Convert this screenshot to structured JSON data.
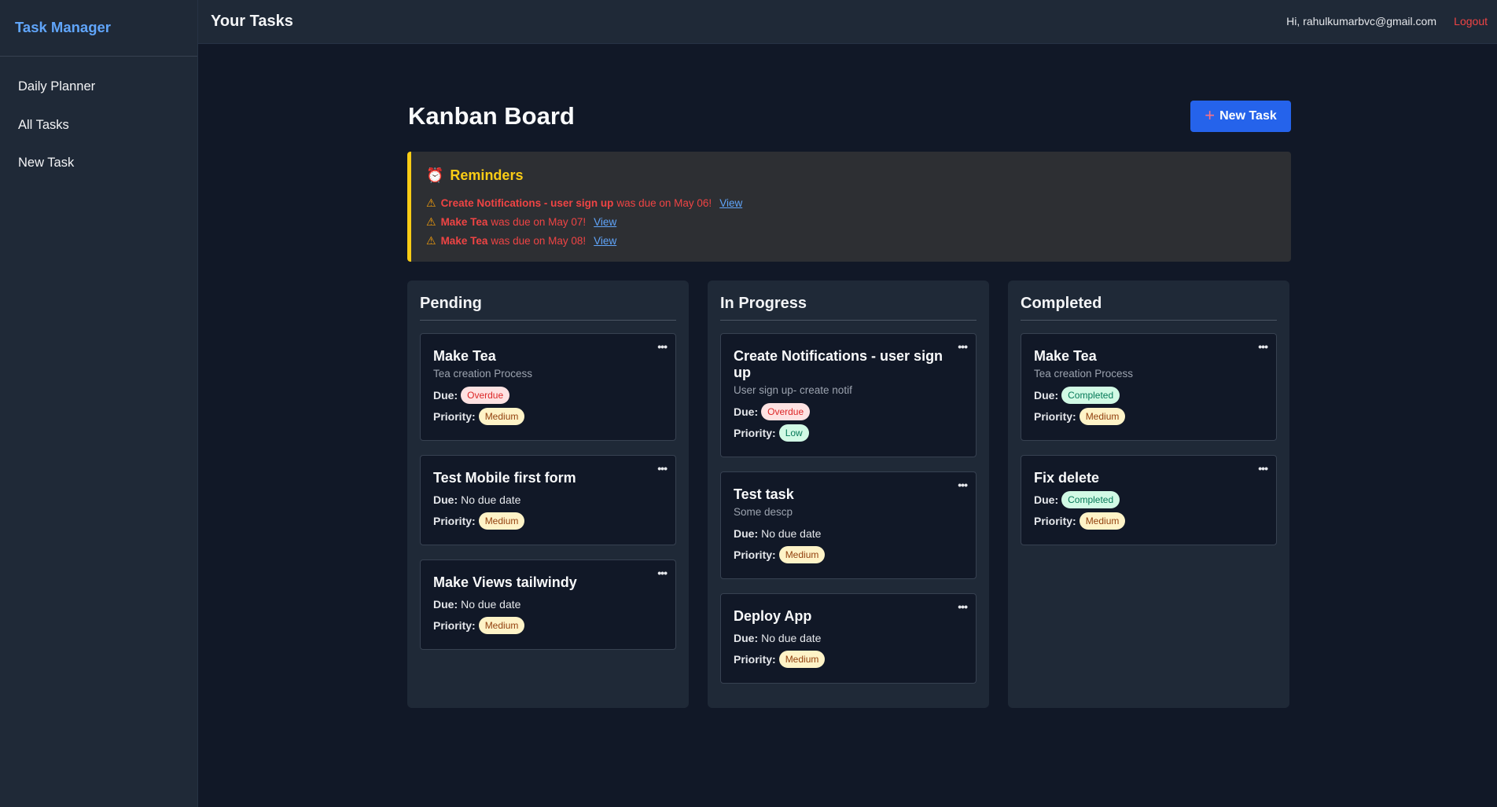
{
  "sidebar": {
    "brand": "Task Manager",
    "items": [
      {
        "label": "Daily Planner"
      },
      {
        "label": "All Tasks"
      },
      {
        "label": "New Task"
      }
    ]
  },
  "topbar": {
    "title": "Your Tasks",
    "user": "Hi, rahulkumarbvc@gmail.com",
    "logout": "Logout"
  },
  "board": {
    "title": "Kanban Board",
    "new_task_label": "New Task",
    "new_task_icon": "+"
  },
  "reminders": {
    "icon": "⏰",
    "title": "Reminders",
    "items": [
      {
        "task": "Create Notifications - user sign up",
        "text": "was due on May 06!",
        "link": "View"
      },
      {
        "task": "Make Tea",
        "text": "was due on May 07!",
        "link": "View"
      },
      {
        "task": "Make Tea",
        "text": "was due on May 08!",
        "link": "View"
      }
    ]
  },
  "labels": {
    "due": "Due:",
    "priority": "Priority:",
    "menu": "•••",
    "warn": "⚠"
  },
  "columns": [
    {
      "title": "Pending",
      "cards": [
        {
          "title": "Make Tea",
          "desc": "Tea creation Process",
          "due": "Overdue",
          "priority": "Medium"
        },
        {
          "title": "Test Mobile first form",
          "due": "No due date",
          "priority": "Medium"
        },
        {
          "title": "Make Views tailwindy",
          "due": "No due date",
          "priority": "Medium"
        }
      ]
    },
    {
      "title": "In Progress",
      "cards": [
        {
          "title": "Create Notifications - user sign up",
          "desc": "User sign up- create notif",
          "due": "Overdue",
          "priority": "Low"
        },
        {
          "title": "Test task",
          "desc": "Some descp",
          "due": "No due date",
          "priority": "Medium"
        },
        {
          "title": "Deploy App",
          "due": "No due date",
          "priority": "Medium"
        }
      ]
    },
    {
      "title": "Completed",
      "cards": [
        {
          "title": "Make Tea",
          "desc": "Tea creation Process",
          "due": "Completed",
          "priority": "Medium"
        },
        {
          "title": "Fix delete",
          "due": "Completed",
          "priority": "Medium"
        }
      ]
    }
  ],
  "colors": {
    "background": "#111827",
    "panel": "#1f2937",
    "accent": "#2563eb",
    "brand": "#60a5fa",
    "reminder_border": "#facc15",
    "danger": "#ef4444"
  }
}
